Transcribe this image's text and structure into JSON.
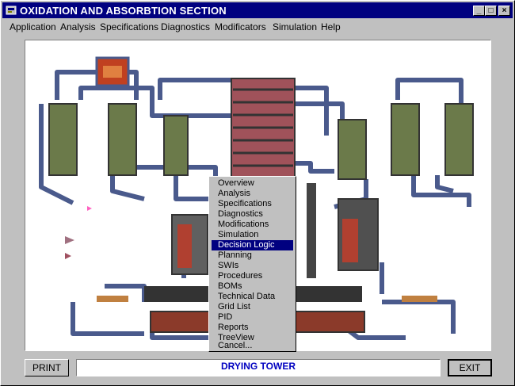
{
  "window": {
    "title": "OXIDATION AND ABSORBTION SECTION"
  },
  "controls": {
    "minimize": "_",
    "maximize": "□",
    "close": "×"
  },
  "menu": [
    "Application",
    "Analysis",
    "Specifications",
    "Diagnostics",
    "Modificators",
    "Simulation",
    "Help"
  ],
  "context_menu": {
    "items": [
      "Overview",
      "Analysis",
      "Specifications",
      "Diagnostics",
      "Modifications",
      "Simulation",
      "Decision Logic",
      "Planning",
      "SWIs",
      "Procedures",
      "BOMs",
      "Technical Data",
      "Grid List",
      "PID",
      "Reports",
      "TreeView",
      "Cancel..."
    ],
    "selected": "Decision Logic"
  },
  "footer": {
    "print_label": "PRINT",
    "status_text": "DRYING TOWER",
    "exit_label": "EXIT"
  },
  "colors": {
    "titlebar": "#000080",
    "status_text": "#0000c0",
    "menu_highlight": "#000080",
    "pipe": "#4a5a8c",
    "vessel": "#6b7a4a",
    "tower": "#a0525a"
  },
  "icons": [
    "app-icon",
    "minimize-icon",
    "maximize-icon",
    "close-icon"
  ]
}
